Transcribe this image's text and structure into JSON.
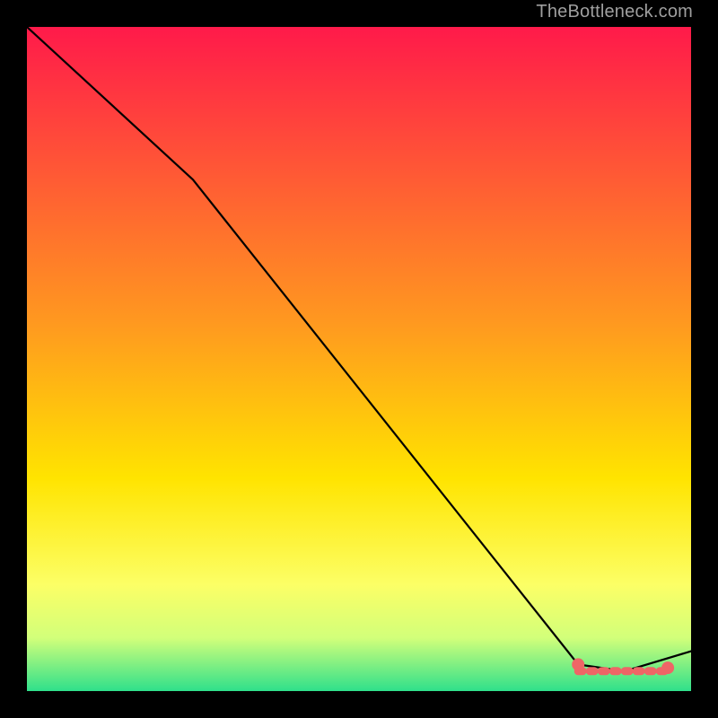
{
  "attribution": "TheBottleneck.com",
  "colors": {
    "marker": "#ee6666",
    "line": "#000000",
    "top_grad": "#ff1a4a",
    "mid_grad": "#ffe400",
    "bot_grad": "#2fe08b",
    "bg": "#000000"
  },
  "chart_data": {
    "type": "line",
    "title": "",
    "xlabel": "",
    "ylabel": "",
    "xlim": [
      0,
      100
    ],
    "ylim": [
      0,
      100
    ],
    "x": [
      0,
      25,
      83,
      90,
      100
    ],
    "values": [
      100,
      77,
      4,
      3,
      6
    ],
    "flat_segment": {
      "x_start": 83,
      "x_end": 96,
      "y": 3
    },
    "markers": [
      {
        "x": 83,
        "y": 4
      },
      {
        "x": 96.5,
        "y": 3.5
      }
    ]
  }
}
